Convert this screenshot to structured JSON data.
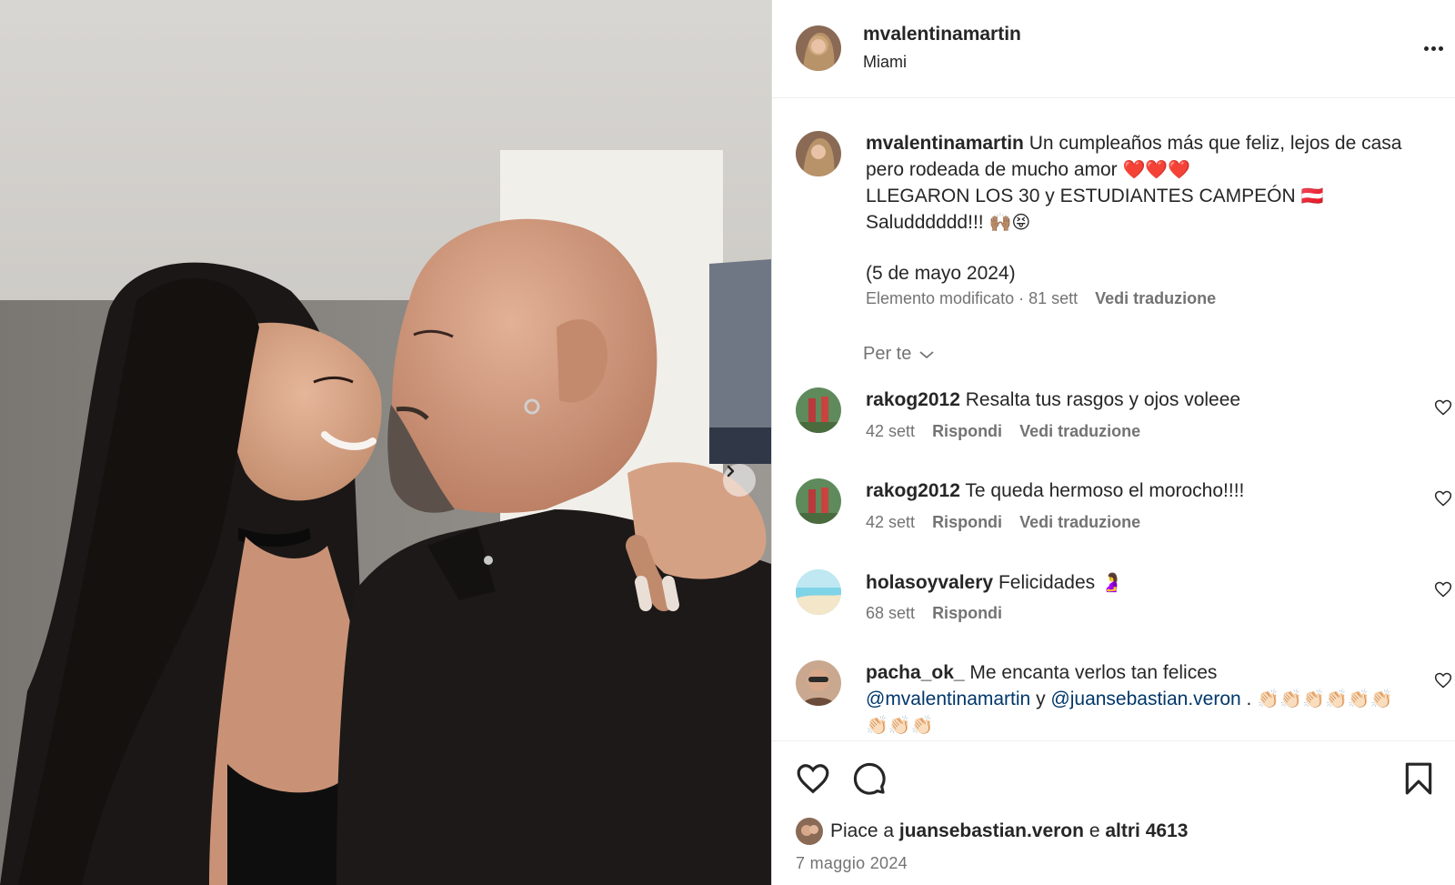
{
  "post": {
    "username": "mvalentinamartin",
    "location": "Miami",
    "caption": {
      "username": "mvalentinamartin",
      "line1": "Un cumpleaños más que feliz, lejos de casa pero rodeada de mucho amor",
      "line1_emoji": "❤️❤️❤️",
      "line2": "LLEGARON LOS 30 y ESTUDIANTES CAMPEÓN",
      "line2_emoji": "🇦🇹",
      "line3": "Saludddddd!!!",
      "line3_emoji": "🙌🏽😝",
      "line4": "(5 de mayo 2024)",
      "meta": "Elemento modificato · 81 sett",
      "translate": "Vedi traduzione"
    },
    "sort_label": "Per te",
    "comments": [
      {
        "username": "rakog2012",
        "text": "Resalta tus rasgos y ojos voleee",
        "age": "42 sett",
        "reply": "Rispondi",
        "translate": "Vedi traduzione"
      },
      {
        "username": "rakog2012",
        "text": "Te queda hermoso el morocho!!!!",
        "age": "42 sett",
        "reply": "Rispondi",
        "translate": "Vedi traduzione"
      },
      {
        "username": "holasoyvalery",
        "text": "Felicidades",
        "emoji": "🤰",
        "age": "68 sett",
        "reply": "Rispondi"
      },
      {
        "username": "pacha_ok_",
        "text_before": "Me encanta verlos tan felices",
        "mention1": "@mvalentinamartin",
        "connector": "y",
        "mention2": "@juansebastian.veron",
        "text_after": ".",
        "emoji": "👏🏻👏🏻👏🏻👏🏻👏🏻👏🏻👏🏻👏🏻👏🏻"
      }
    ],
    "likes": {
      "prefix": "Piace a",
      "user": "juansebastian.veron",
      "connector": "e",
      "others": "altri 4613"
    },
    "date": "7 maggio 2024",
    "icons": [
      "heart-icon",
      "comment-icon",
      "bookmark-icon",
      "more-icon",
      "chevron-right-icon",
      "chevron-down-icon"
    ],
    "colors": {
      "link": "#00376b",
      "muted": "#737373",
      "text": "#262626"
    }
  }
}
